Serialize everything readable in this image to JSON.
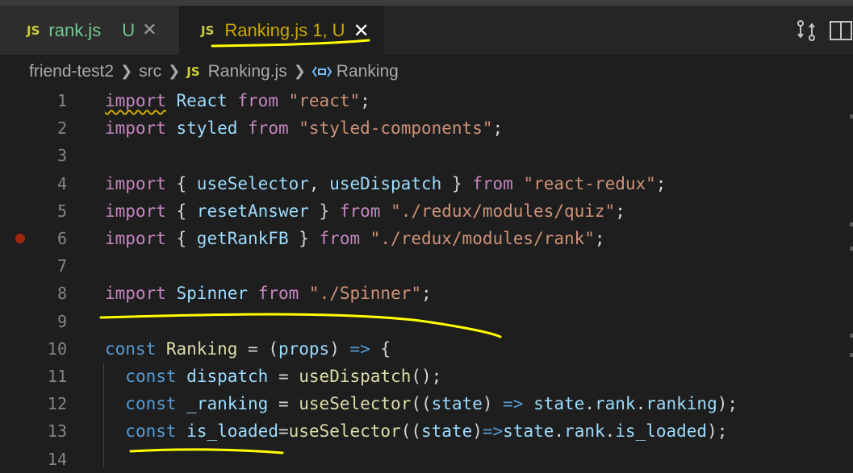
{
  "tabs": [
    {
      "file_icon": "JS",
      "label": "rank.js",
      "status": "U",
      "active": false
    },
    {
      "file_icon": "JS",
      "label": "Ranking.js 1, U",
      "active": true
    }
  ],
  "breadcrumb": {
    "folder": "friend-test2",
    "subfolder": "src",
    "file_icon": "JS",
    "file": "Ranking.js",
    "symbol": "Ranking"
  },
  "code_lines": [
    {
      "n": "1",
      "tokens": [
        [
          "import",
          "kw2 squig"
        ],
        [
          " ",
          ""
        ],
        [
          "React",
          "vr"
        ],
        [
          " ",
          ""
        ],
        [
          "from",
          "kw2"
        ],
        [
          " ",
          ""
        ],
        [
          "\"react\"",
          "st"
        ],
        [
          ";",
          "pl"
        ]
      ]
    },
    {
      "n": "2",
      "tokens": [
        [
          "import",
          "kw2"
        ],
        [
          " ",
          ""
        ],
        [
          "styled",
          "vr"
        ],
        [
          " ",
          ""
        ],
        [
          "from",
          "kw2"
        ],
        [
          " ",
          ""
        ],
        [
          "\"styled-components\"",
          "st"
        ],
        [
          ";",
          "pl"
        ]
      ]
    },
    {
      "n": "3",
      "tokens": []
    },
    {
      "n": "4",
      "tokens": [
        [
          "import",
          "kw2"
        ],
        [
          " { ",
          "pl"
        ],
        [
          "useSelector",
          "vr"
        ],
        [
          ", ",
          "pl"
        ],
        [
          "useDispatch",
          "vr"
        ],
        [
          " } ",
          "pl"
        ],
        [
          "from",
          "kw2"
        ],
        [
          " ",
          ""
        ],
        [
          "\"react-redux\"",
          "st"
        ],
        [
          ";",
          "pl"
        ]
      ]
    },
    {
      "n": "5",
      "tokens": [
        [
          "import",
          "kw2"
        ],
        [
          " { ",
          "pl"
        ],
        [
          "resetAnswer",
          "vr"
        ],
        [
          " } ",
          "pl"
        ],
        [
          "from",
          "kw2"
        ],
        [
          " ",
          ""
        ],
        [
          "\"./redux/modules/quiz\"",
          "st"
        ],
        [
          ";",
          "pl"
        ]
      ]
    },
    {
      "n": "6",
      "tokens": [
        [
          "import",
          "kw2"
        ],
        [
          " { ",
          "pl"
        ],
        [
          "getRankFB",
          "vr"
        ],
        [
          " } ",
          "pl"
        ],
        [
          "from",
          "kw2"
        ],
        [
          " ",
          ""
        ],
        [
          "\"./redux/modules/rank\"",
          "st"
        ],
        [
          ";",
          "pl"
        ]
      ]
    },
    {
      "n": "7",
      "tokens": []
    },
    {
      "n": "8",
      "tokens": [
        [
          "import",
          "kw2"
        ],
        [
          " ",
          ""
        ],
        [
          "Spinner",
          "vr"
        ],
        [
          " ",
          ""
        ],
        [
          "from",
          "kw2"
        ],
        [
          " ",
          ""
        ],
        [
          "\"./Spinner\"",
          "st"
        ],
        [
          ";",
          "pl"
        ]
      ]
    },
    {
      "n": "9",
      "tokens": []
    },
    {
      "n": "10",
      "tokens": [
        [
          "const",
          "kw"
        ],
        [
          " ",
          ""
        ],
        [
          "Ranking",
          "fn"
        ],
        [
          " = (",
          "pl"
        ],
        [
          "props",
          "vr"
        ],
        [
          ") ",
          "pl"
        ],
        [
          "=>",
          "kw"
        ],
        [
          " {",
          "pl"
        ]
      ]
    },
    {
      "n": "11",
      "tokens": [
        [
          "  ",
          ""
        ],
        [
          "const",
          "kw"
        ],
        [
          " ",
          ""
        ],
        [
          "dispatch",
          "vr"
        ],
        [
          " = ",
          "pl"
        ],
        [
          "useDispatch",
          "fn"
        ],
        [
          "();",
          "pl"
        ]
      ]
    },
    {
      "n": "12",
      "tokens": [
        [
          "  ",
          ""
        ],
        [
          "const",
          "kw"
        ],
        [
          " ",
          ""
        ],
        [
          "_ranking",
          "vr"
        ],
        [
          " = ",
          "pl"
        ],
        [
          "useSelector",
          "fn"
        ],
        [
          "((",
          "pl"
        ],
        [
          "state",
          "vr"
        ],
        [
          ") ",
          "pl"
        ],
        [
          "=>",
          "kw"
        ],
        [
          " ",
          ""
        ],
        [
          "state",
          "vr"
        ],
        [
          ".",
          "pl"
        ],
        [
          "rank",
          "vr"
        ],
        [
          ".",
          "pl"
        ],
        [
          "ranking",
          "vr"
        ],
        [
          ");",
          "pl"
        ]
      ]
    },
    {
      "n": "13",
      "tokens": [
        [
          "  ",
          ""
        ],
        [
          "const",
          "kw"
        ],
        [
          " ",
          ""
        ],
        [
          "is_loaded",
          "vr"
        ],
        [
          "=",
          "pl"
        ],
        [
          "useSelector",
          "fn"
        ],
        [
          "((",
          "pl"
        ],
        [
          "state",
          "vr"
        ],
        [
          ")",
          "pl"
        ],
        [
          "=>",
          "kw"
        ],
        [
          "state",
          "vr"
        ],
        [
          ".",
          "pl"
        ],
        [
          "rank",
          "vr"
        ],
        [
          ".",
          "pl"
        ],
        [
          "is_loaded",
          "vr"
        ],
        [
          ");",
          "pl"
        ]
      ]
    },
    {
      "n": "14",
      "tokens": []
    }
  ],
  "breakpoint_line": "6",
  "colors": {
    "annotation": "#ffff00",
    "modified": "#73c991",
    "warning": "#cca700"
  }
}
